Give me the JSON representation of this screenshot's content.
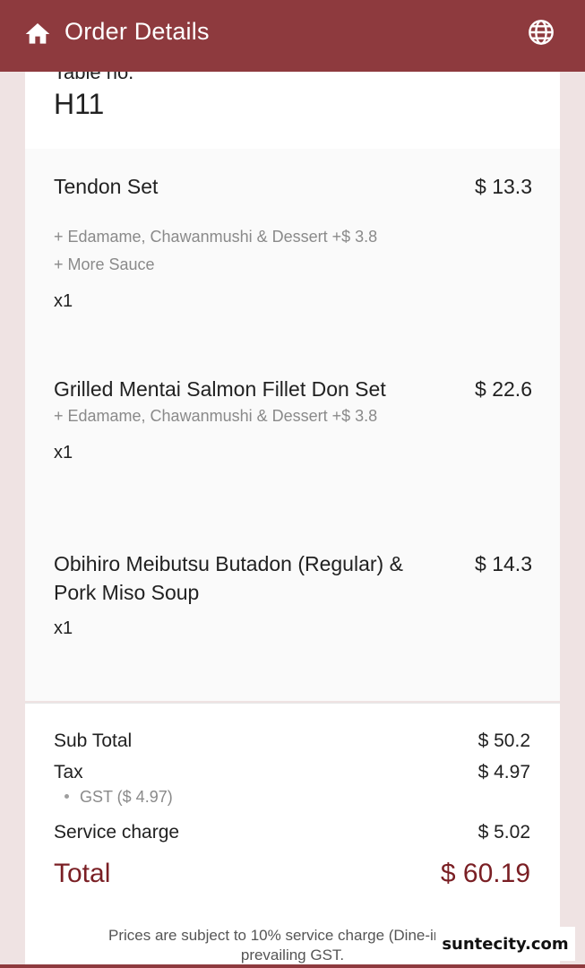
{
  "appbar": {
    "title": "Order Details",
    "home_icon": "home-icon",
    "language_icon": "globe-icon",
    "color": "#8e3a3e"
  },
  "table": {
    "label": "Table no.",
    "value": "H11"
  },
  "items": [
    {
      "name": "Tendon Set",
      "price": "$ 13.3",
      "addons": [
        "+ Edamame, Chawanmushi & Dessert  +$ 3.8",
        "+ More Sauce"
      ],
      "qty": "x1"
    },
    {
      "name": "Grilled Mentai Salmon Fillet Don Set",
      "price": "$ 22.6",
      "addons": [
        "+ Edamame, Chawanmushi & Dessert  +$ 3.8"
      ],
      "qty": "x1"
    },
    {
      "name": "Obihiro Meibutsu Butadon (Regular) & Pork Miso Soup",
      "price": "$ 14.3",
      "addons": [],
      "qty": "x1"
    }
  ],
  "summary": {
    "subtotal_label": "Sub Total",
    "subtotal_value": "$ 50.2",
    "tax_label": "Tax",
    "tax_value": "$ 4.97",
    "gst_line": "GST ($ 4.97)",
    "service_label": "Service charge",
    "service_value": "$ 5.02",
    "total_label": "Total",
    "total_value": "$ 60.19",
    "total_color": "#7a1f24",
    "note_line1": "Prices are subject to 10% service charge (Dine-in) and",
    "note_line2": "prevailing GST."
  },
  "watermark": "suntecity.com"
}
